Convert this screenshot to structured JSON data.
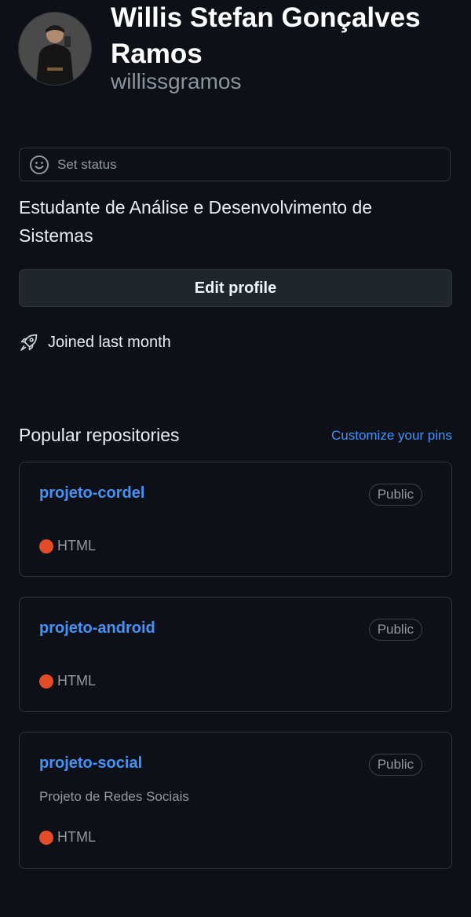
{
  "profile": {
    "name": "Willis Stefan Gonçalves Ramos",
    "login": "willissgramos",
    "bio": "Estudante de Análise e Desenvolvimento de Sistemas",
    "joined": "Joined last month"
  },
  "status": {
    "label": "Set status",
    "icon": "smiley-icon"
  },
  "actions": {
    "edit_profile": "Edit profile"
  },
  "popular": {
    "title": "Popular repositories",
    "customize": "Customize your pins",
    "repos": [
      {
        "name": "projeto-cordel",
        "visibility": "Public",
        "description": "",
        "language": "HTML",
        "language_color": "#e34c26"
      },
      {
        "name": "projeto-android",
        "visibility": "Public",
        "description": "",
        "language": "HTML",
        "language_color": "#e34c26"
      },
      {
        "name": "projeto-social",
        "visibility": "Public",
        "description": "Projeto de Redes Sociais",
        "language": "HTML",
        "language_color": "#e34c26"
      }
    ]
  },
  "colors": {
    "background": "#0d1117",
    "accent": "#4493f8",
    "border": "#30363d"
  }
}
